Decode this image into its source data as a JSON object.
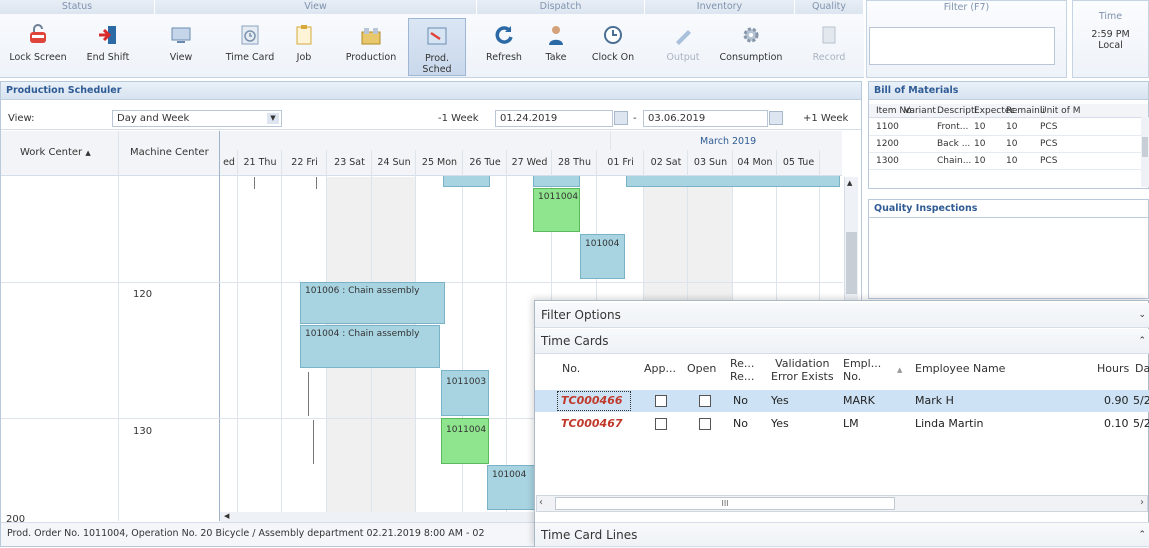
{
  "ribbon": {
    "groups": {
      "status": "Status",
      "view": "View",
      "dispatch": "Dispatch",
      "inventory": "Inventory",
      "quality": "Quality"
    },
    "buttons": {
      "lock_screen": "Lock Screen",
      "end_shift": "End Shift",
      "view": "View",
      "time_card": "Time Card",
      "job": "Job",
      "production": "Production",
      "prod_sched": "Prod. Sched",
      "refresh": "Refresh",
      "take": "Take",
      "clock_on": "Clock On",
      "output": "Output",
      "consumption": "Consumption",
      "record": "Record"
    },
    "filter_label": "Filter (F7)",
    "time_label": "Time",
    "time_value": "2:59 PM",
    "time_zone": "Local"
  },
  "scheduler": {
    "title": "Production Scheduler",
    "view_label": "View:",
    "view_value": "Day and Week",
    "prev_week": "-1 Week",
    "next_week": "+1 Week",
    "date_from": "01.24.2019",
    "date_sep": "-",
    "date_to": "03.06.2019",
    "col_work_center": "Work Center",
    "col_machine_center": "Machine Center",
    "month_label": "March 2019",
    "days": [
      "ed",
      "21 Thu",
      "22 Fri",
      "23 Sat",
      "24 Sun",
      "25 Mon",
      "26 Tue",
      "27 Wed",
      "28 Thu",
      "01 Fri",
      "02 Sat",
      "03 Sun",
      "04 Mon",
      "05 Tue"
    ],
    "machine_centers": [
      "120",
      "130"
    ],
    "work_center_bottom": "200",
    "bars": {
      "b1": "1011004",
      "b2": "101004",
      "b3": "101006 : Chain assembly",
      "b4": "101004 : Chain assembly",
      "b5": "1011003",
      "b6": "1011004",
      "b7": "101004"
    },
    "status_bar": "Prod. Order No. 1011004, Operation No. 20   Bicycle / Assembly department   02.21.2019 8:00 AM - 02"
  },
  "bom": {
    "title": "Bill of Materials",
    "columns": [
      "Item No",
      "Variant",
      "Descripti",
      "Expectec",
      "Remainii",
      "Unit of M"
    ],
    "rows": [
      [
        "1100",
        "",
        "Front...",
        "10",
        "10",
        "PCS"
      ],
      [
        "1200",
        "",
        "Back ...",
        "10",
        "10",
        "PCS"
      ],
      [
        "1300",
        "",
        "Chain...",
        "10",
        "10",
        "PCS"
      ]
    ]
  },
  "quality": {
    "title": "Quality Inspections"
  },
  "timecards": {
    "filter_options": "Filter Options",
    "section": "Time Cards",
    "lines_section": "Time Card Lines",
    "col_no": "No.",
    "col_app": "App...",
    "col_open": "Open",
    "col_re_1": "Re...",
    "col_re_2": "Re...",
    "col_val_1": "Validation",
    "col_val_2": "Error Exists",
    "col_empl_1": "Empl...",
    "col_empl_2": "No.",
    "col_name": "Employee Name",
    "col_hours": "Hours",
    "col_date": "Da",
    "rows": [
      {
        "no": "TC000466",
        "re": "No",
        "val": "Yes",
        "empl": "MARK",
        "name": "Mark H",
        "hours": "0.90",
        "date": "5/2"
      },
      {
        "no": "TC000467",
        "re": "No",
        "val": "Yes",
        "empl": "LM",
        "name": "Linda Martin",
        "hours": "0.10",
        "date": "5/2"
      }
    ],
    "scroll_thumb": "III"
  },
  "colors": {
    "accent": "#2f5b94",
    "bar_blue": "#a8d4e2",
    "bar_green": "#8ee58e",
    "red_link": "#c0392b",
    "selected_row": "#cde3f5"
  }
}
